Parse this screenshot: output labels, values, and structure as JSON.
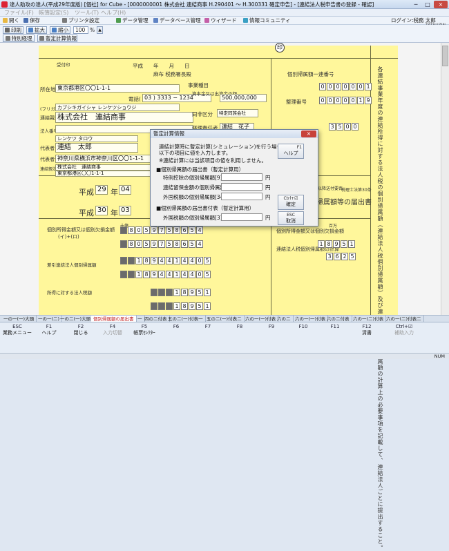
{
  "window": {
    "title": "達人助攻の達人(平成29年度版) [個社] for Cube - [0000000001 株式会社 連結商事 H.290401 ～ H.300331 確定申告] - [連結法人税申告書の登録 - 確認]",
    "minimize": "─",
    "maximize": "□",
    "close": "×"
  },
  "menu": [
    "ファイル(F)",
    "帳簿設定(S)",
    "ツール(T)",
    "ヘルプ(H)"
  ],
  "toolbar1": {
    "items": [
      "開く",
      "保存",
      "プリンタ設定",
      "データ管理",
      "データベース管理",
      "ウィザード",
      "情報コミュニティ"
    ],
    "login": "ログイン:税務 太郎",
    "brand": "TATSUZIN"
  },
  "toolbar2": {
    "print": "印刷",
    "zoom_in": "拡大",
    "zoom_out": "縮小",
    "zoom_value": "100",
    "zoom_unit": "%",
    "zoom_spin": "▲"
  },
  "toolbar3": {
    "btn1": "特別経理",
    "btn2": "暫定計算情報"
  },
  "form": {
    "receipt": "受付印",
    "date_label": "平成　　年　　月　　日",
    "tax_office": "麻布 税務署長殿",
    "address_label": "所在地",
    "address": "東京都港区〇〇1-1-1",
    "phone_label": "電話(",
    "phone": "03 ) 3333 − 1234",
    "kana_label": "(フリガナ)",
    "kana": "カブシキガイシャ レンケツショウジ",
    "corp_label": "連結親法人名",
    "corp_name": "株式会社　連結商事",
    "corp_no_label": "法人番号",
    "rep_kana": "レンケツ タロウ",
    "rep_label": "代表者氏名",
    "rep_name": "連結　太郎",
    "rep_addr_label": "代表者住所",
    "rep_addr": "神奈川県横浜市神奈川区〇〇1-1-1",
    "parent_label": "連結親法人名",
    "parent_name": "株式会社　連結商事",
    "parent_addr": "東京都港区〇〇1-1-1",
    "era1": "平成",
    "y1": "29",
    "m1": "04",
    "era2": "平成",
    "y2": "30",
    "m2": "03",
    "business_label": "事業種目",
    "capital_label": "資本金又は出資金の額",
    "capital": "500,000,000",
    "yen": "円",
    "kubun_label": "同非区分",
    "kubun_val": "特定同族会社",
    "group_no_label": "個別帰属額一連番号",
    "group_no": "0000001",
    "corp_no_box": "0000019",
    "serial_label": "整理番号",
    "accountant_label": "経理責任者",
    "accountant": "連結　花子",
    "stamp": "印",
    "right_title": "個別帰属額等の届出書",
    "annual_report": "翌年以降送付要否",
    "area_label": "百万",
    "calc_title": "個別所得金額又は個別欠損金額",
    "calc_sub": "(イ)+(ロ)",
    "row_num1": "8059758654",
    "row_num2": "8059758654",
    "row_num3": "1894414405",
    "row_num4": "1894414405",
    "row_num5": "18951",
    "row_num6": "18951",
    "row_num7": "3625",
    "sec_head1": "差引連結法人個別帰属額",
    "sec_head2": "所得に対する法人税額",
    "r_label13": "連結法人税個別帰属額の計算",
    "r_num12": "18951",
    "r_num13": "3625",
    "r_label_tax": "個別所得金額又は個別欠損金額",
    "tenyen": "十億",
    "big_vertical": "各連結事業年度の連結所得に対する法人税の個別帰属額（連結法人税個別帰属額）及び連結法人税個別帰属額の計算上の必要事項を記載して、連結法人ごとに提出すること。",
    "shocho": "税務署処理欄",
    "shomei": "書面添付",
    "shomei_no": "税理士法第30条"
  },
  "dialog": {
    "title": "暫定計算情報",
    "close": "×",
    "desc1": "連結計算時に暫定計算(シミュレーション)を行う場合に、",
    "desc2": "以下の項目に値を入力します。",
    "note": "※連結計算には当該項目の値を利用しません。",
    "sec1": "■個別帰属額の届出書（暫定計算用）",
    "f1_label": "特例控除の個別帰属額[9]",
    "f2_label": "連結留保金額の個別帰属額[10]",
    "f3_label": "外国税額の個別帰属額[34]",
    "sec2": "■個別帰属額の届出書付表（暫定計算用）",
    "f4_label": "外国税額の個別帰属額[3]",
    "unit": "円",
    "help_key": "F1",
    "help": "ヘルプ",
    "ok_key": "Ctrl+",
    "ok_check": "☑",
    "ok": "確定",
    "cancel_key": "ESC",
    "cancel": "取消"
  },
  "tabs": [
    "一の一(一)大頭",
    "一の一(二)",
    "一の二(一)大頭",
    "個別帰属額の届出書",
    "一",
    "四の二付表",
    "五の二(一)付表一",
    "五の二(一)付表二",
    "六の一(一)付表",
    "六の二",
    "六の一(一)付表",
    "六の二付表",
    "六の一(二)付表",
    "六の一(二)付表二"
  ],
  "fkeys": [
    {
      "k": "ESC",
      "l": "業務メニュー",
      "dis": false
    },
    {
      "k": "F1",
      "l": "ヘルプ",
      "dis": false
    },
    {
      "k": "F2",
      "l": "閉じる",
      "dis": false
    },
    {
      "k": "F4",
      "l": "入力切替",
      "dis": true
    },
    {
      "k": "F5",
      "l": "帳票ｾﾚｸﾀｰ",
      "dis": false
    },
    {
      "k": "F6",
      "l": "",
      "dis": false
    },
    {
      "k": "F7",
      "l": "",
      "dis": false
    },
    {
      "k": "F8",
      "l": "",
      "dis": false
    },
    {
      "k": "F9",
      "l": "",
      "dis": false
    },
    {
      "k": "F10",
      "l": "",
      "dis": false
    },
    {
      "k": "F11",
      "l": "",
      "dis": false
    },
    {
      "k": "F12",
      "l": "清書",
      "dis": false
    },
    {
      "k": "Ctrl+☑",
      "l": "補助入力",
      "dis": true
    }
  ],
  "status": {
    "num": "NUM"
  }
}
